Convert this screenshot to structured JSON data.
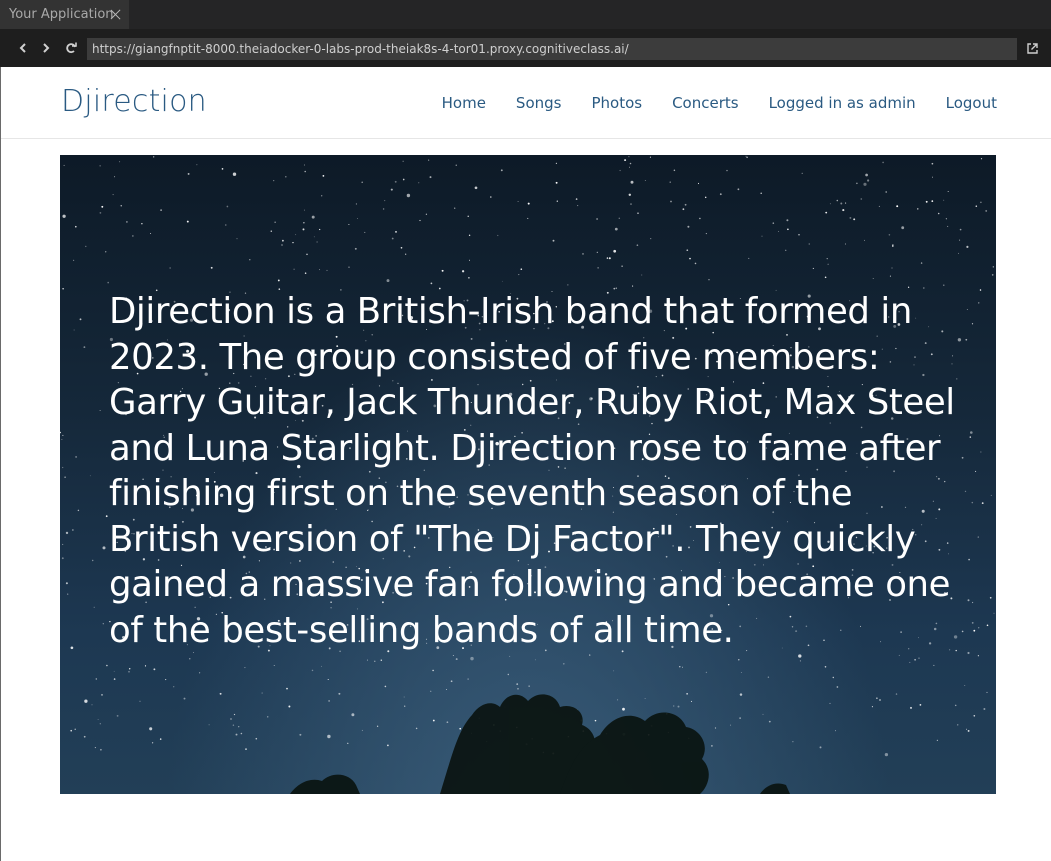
{
  "browser": {
    "tab_title": "Your Application",
    "url": "https://giangfnptit-8000.theiadocker-0-labs-prod-theiak8s-4-tor01.proxy.cognitiveclass.ai/"
  },
  "site": {
    "brand": "Djirection",
    "nav": {
      "home": "Home",
      "songs": "Songs",
      "photos": "Photos",
      "concerts": "Concerts",
      "user": "Logged in as admin",
      "logout": "Logout"
    }
  },
  "hero": {
    "text": "Djirection is a British-Irish band that formed in 2023. The group consisted of five members: Garry Guitar, Jack Thunder, Ruby Riot, Max Steel and Luna Starlight. Djirection rose to fame after finishing first on the seventh season of the British version of \"The Dj Factor\". They quickly gained a massive fan following and became one of the best-selling bands of all time."
  },
  "colors": {
    "link": "#2a5a82",
    "chrome_bg": "#1e1e1e",
    "tabbar_bg": "#252526"
  }
}
